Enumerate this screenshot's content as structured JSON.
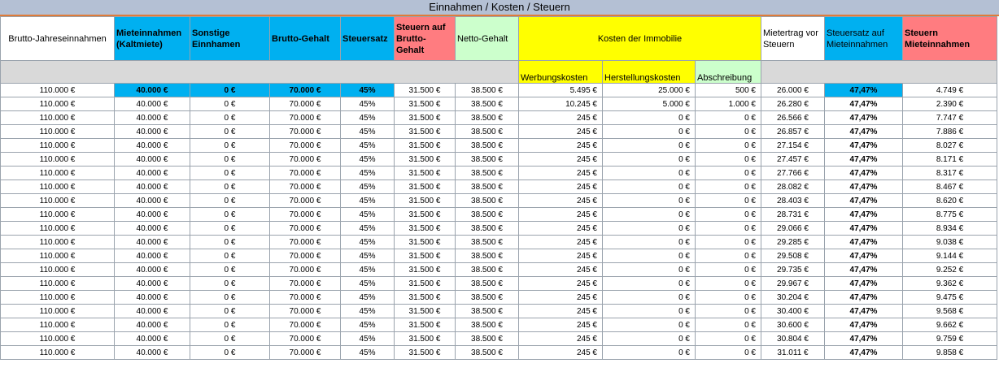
{
  "sheet": {
    "title": "Einnahmen / Kosten / Steuern",
    "headers": {
      "brutto_jahreseinnahmen": "Brutto-Jahreseinnahmen",
      "mieteinnahmen": "Mieteinnahmen (Kaltmiete)",
      "sonstige": "Sonstige Einnhamen",
      "brutto_gehalt": "Brutto-Gehalt",
      "steuersatz": "Steuersatz",
      "steuern_brutto": "Steuern auf Brutto-Gehalt",
      "netto_gehalt": "Netto-Gehalt",
      "kosten_immobilie": "Kosten der Immobilie",
      "mieterertrag": "Mietertrag vor Steuern",
      "steuersatz_miete": "Steuersatz auf Mieteinnahmen",
      "steuern_miete": "Steuern Mieteinnahmen",
      "werbungskosten": "Werbungskosten",
      "herstellungskosten": "Herstellungskosten",
      "abschreibung": "Abschreibung"
    },
    "colors": {
      "title_bar": "#b4c0d4",
      "accent_blue": "#00b0f0",
      "accent_red": "#ff7c80",
      "accent_green": "#ccffcc",
      "accent_yellow": "#ffff00"
    },
    "rows": [
      [
        "110.000 €",
        "40.000 €",
        "0 €",
        "70.000 €",
        "45%",
        "31.500 €",
        "38.500 €",
        "5.495 €",
        "25.000 €",
        "500 €",
        "26.000 €",
        "47,47%",
        "4.749 €"
      ],
      [
        "110.000 €",
        "40.000 €",
        "0 €",
        "70.000 €",
        "45%",
        "31.500 €",
        "38.500 €",
        "10.245 €",
        "5.000 €",
        "1.000 €",
        "26.280 €",
        "47,47%",
        "2.390 €"
      ],
      [
        "110.000 €",
        "40.000 €",
        "0 €",
        "70.000 €",
        "45%",
        "31.500 €",
        "38.500 €",
        "245 €",
        "0 €",
        "0 €",
        "26.566 €",
        "47,47%",
        "7.747 €"
      ],
      [
        "110.000 €",
        "40.000 €",
        "0 €",
        "70.000 €",
        "45%",
        "31.500 €",
        "38.500 €",
        "245 €",
        "0 €",
        "0 €",
        "26.857 €",
        "47,47%",
        "7.886 €"
      ],
      [
        "110.000 €",
        "40.000 €",
        "0 €",
        "70.000 €",
        "45%",
        "31.500 €",
        "38.500 €",
        "245 €",
        "0 €",
        "0 €",
        "27.154 €",
        "47,47%",
        "8.027 €"
      ],
      [
        "110.000 €",
        "40.000 €",
        "0 €",
        "70.000 €",
        "45%",
        "31.500 €",
        "38.500 €",
        "245 €",
        "0 €",
        "0 €",
        "27.457 €",
        "47,47%",
        "8.171 €"
      ],
      [
        "110.000 €",
        "40.000 €",
        "0 €",
        "70.000 €",
        "45%",
        "31.500 €",
        "38.500 €",
        "245 €",
        "0 €",
        "0 €",
        "27.766 €",
        "47,47%",
        "8.317 €"
      ],
      [
        "110.000 €",
        "40.000 €",
        "0 €",
        "70.000 €",
        "45%",
        "31.500 €",
        "38.500 €",
        "245 €",
        "0 €",
        "0 €",
        "28.082 €",
        "47,47%",
        "8.467 €"
      ],
      [
        "110.000 €",
        "40.000 €",
        "0 €",
        "70.000 €",
        "45%",
        "31.500 €",
        "38.500 €",
        "245 €",
        "0 €",
        "0 €",
        "28.403 €",
        "47,47%",
        "8.620 €"
      ],
      [
        "110.000 €",
        "40.000 €",
        "0 €",
        "70.000 €",
        "45%",
        "31.500 €",
        "38.500 €",
        "245 €",
        "0 €",
        "0 €",
        "28.731 €",
        "47,47%",
        "8.775 €"
      ],
      [
        "110.000 €",
        "40.000 €",
        "0 €",
        "70.000 €",
        "45%",
        "31.500 €",
        "38.500 €",
        "245 €",
        "0 €",
        "0 €",
        "29.066 €",
        "47,47%",
        "8.934 €"
      ],
      [
        "110.000 €",
        "40.000 €",
        "0 €",
        "70.000 €",
        "45%",
        "31.500 €",
        "38.500 €",
        "245 €",
        "0 €",
        "0 €",
        "29.285 €",
        "47,47%",
        "9.038 €"
      ],
      [
        "110.000 €",
        "40.000 €",
        "0 €",
        "70.000 €",
        "45%",
        "31.500 €",
        "38.500 €",
        "245 €",
        "0 €",
        "0 €",
        "29.508 €",
        "47,47%",
        "9.144 €"
      ],
      [
        "110.000 €",
        "40.000 €",
        "0 €",
        "70.000 €",
        "45%",
        "31.500 €",
        "38.500 €",
        "245 €",
        "0 €",
        "0 €",
        "29.735 €",
        "47,47%",
        "9.252 €"
      ],
      [
        "110.000 €",
        "40.000 €",
        "0 €",
        "70.000 €",
        "45%",
        "31.500 €",
        "38.500 €",
        "245 €",
        "0 €",
        "0 €",
        "29.967 €",
        "47,47%",
        "9.362 €"
      ],
      [
        "110.000 €",
        "40.000 €",
        "0 €",
        "70.000 €",
        "45%",
        "31.500 €",
        "38.500 €",
        "245 €",
        "0 €",
        "0 €",
        "30.204 €",
        "47,47%",
        "9.475 €"
      ],
      [
        "110.000 €",
        "40.000 €",
        "0 €",
        "70.000 €",
        "45%",
        "31.500 €",
        "38.500 €",
        "245 €",
        "0 €",
        "0 €",
        "30.400 €",
        "47,47%",
        "9.568 €"
      ],
      [
        "110.000 €",
        "40.000 €",
        "0 €",
        "70.000 €",
        "45%",
        "31.500 €",
        "38.500 €",
        "245 €",
        "0 €",
        "0 €",
        "30.600 €",
        "47,47%",
        "9.662 €"
      ],
      [
        "110.000 €",
        "40.000 €",
        "0 €",
        "70.000 €",
        "45%",
        "31.500 €",
        "38.500 €",
        "245 €",
        "0 €",
        "0 €",
        "30.804 €",
        "47,47%",
        "9.759 €"
      ],
      [
        "110.000 €",
        "40.000 €",
        "0 €",
        "70.000 €",
        "45%",
        "31.500 €",
        "38.500 €",
        "245 €",
        "0 €",
        "0 €",
        "31.011 €",
        "47,47%",
        "9.858 €"
      ]
    ]
  }
}
